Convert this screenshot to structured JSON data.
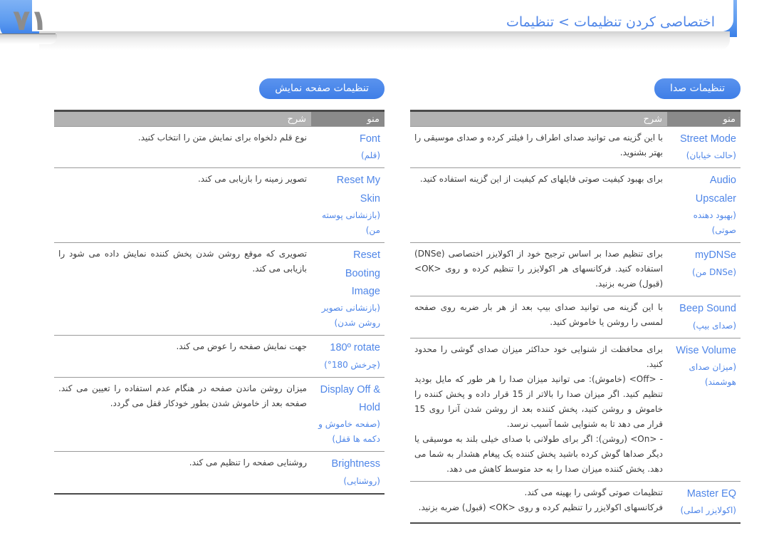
{
  "header": {
    "page_number": "۷۱",
    "breadcrumb": "اختصاصی کردن تنظیمات > تنظیمات",
    "accent_color": "#4f86e8",
    "bar_color": "#5e9cf0"
  },
  "columns": {
    "sound": {
      "badge": "تنظیمات صدا",
      "headers": {
        "menu": "منو",
        "desc": "شرح"
      },
      "rows": [
        {
          "menu_en": "Street Mode",
          "menu_fa": "(حالت خیابان)",
          "desc": [
            "با این گزینه می توانید صدای اطراف را فیلتر کرده و صدای موسیقی را بهتر بشنوید."
          ]
        },
        {
          "menu_en": "Audio Upscaler",
          "menu_fa": "(بهبود دهنده صوتی)",
          "desc": [
            "برای بهبود کیفیت صوتی فایلهای کم کیفیت از این گزینه استفاده کنید."
          ]
        },
        {
          "menu_en": "myDNSe",
          "menu_fa": "(DNSe من)",
          "desc": [
            "برای تنظیم صدا بر اساس ترجیح خود از اکولایزر اختصاصی (DNSe) استفاده کنید. فرکانسهای هر اکولایزر را تنظیم کرده و روی <OK> (قبول) ضربه بزنید."
          ]
        },
        {
          "menu_en": "Beep Sound",
          "menu_fa": "(صدای بیپ)",
          "desc": [
            "با این گزینه می توانید صدای بیپ بعد از هر بار ضربه روی صفحه لمسی را روشن یا خاموش کنید."
          ]
        },
        {
          "menu_en": "Wise Volume",
          "menu_fa": "(میزان صدای هوشمند)",
          "desc": [
            "برای محافظت از شنوایی خود حداکثر میزان صدای گوشی را محدود کنید.",
            "- <Off> (خاموش): می توانید میزان صدا را هر طور که مایل بودید تنظیم کنید. اگر میزان صدا را بالاتر از 15 قرار داده و پخش کننده را خاموش و روشن کنید، پخش کننده بعد از روشن شدن آنرا روی 15 قرار می دهد تا به شنوایی شما آسیب نرسد.",
            "- <On> (روشن): اگر برای طولانی با صدای خیلی بلند به موسیقی یا دیگر صداها گوش کرده باشید پخش کننده یک پیغام هشدار به شما می دهد. پخش کننده میزان صدا را به حد متوسط کاهش می دهد."
          ]
        },
        {
          "menu_en": "Master EQ",
          "menu_fa": "(اکولایزر اصلی)",
          "desc": [
            "تنظیمات صوتی گوشی را بهینه می کند.",
            "فرکانسهای اکولایزر را تنظیم کرده و روی <OK> (قبول) ضربه بزنید."
          ]
        }
      ]
    },
    "display": {
      "badge": "تنظیمات صفحه نمایش",
      "headers": {
        "menu": "منو",
        "desc": "شرح"
      },
      "rows": [
        {
          "menu_en": "Font",
          "menu_fa": "(قلم)",
          "desc": [
            "نوع قلم دلخواه برای نمایش متن را انتخاب کنید."
          ]
        },
        {
          "menu_en": "Reset My Skin",
          "menu_fa": "(بازنشانی پوسته من)",
          "desc": [
            "تصویر زمینه را بازیابی می کند."
          ]
        },
        {
          "menu_en": "Reset Booting Image",
          "menu_fa": "(بازنشانی تصویر روشن شدن)",
          "desc": [
            "تصویری که موقع روشن شدن پخش کننده نمایش داده می شود را بازیابی می کند."
          ]
        },
        {
          "menu_en": "180º rotate",
          "menu_fa": "(چرخش 180°)",
          "desc": [
            "جهت نمایش صفحه را عوض می کند."
          ]
        },
        {
          "menu_en": "Display Off & Hold",
          "menu_fa": "(صفحه خاموش و دکمه ها قفل)",
          "desc": [
            "میزان روشن ماندن صفحه در هنگام عدم استفاده را تعیین می کند. صفحه بعد از خاموش شدن بطور خودکار قفل می گردد."
          ]
        },
        {
          "menu_en": "Brightness",
          "menu_fa": "(روشنایی)",
          "desc": [
            "روشنایی صفحه را تنظیم می کند."
          ]
        }
      ]
    }
  }
}
